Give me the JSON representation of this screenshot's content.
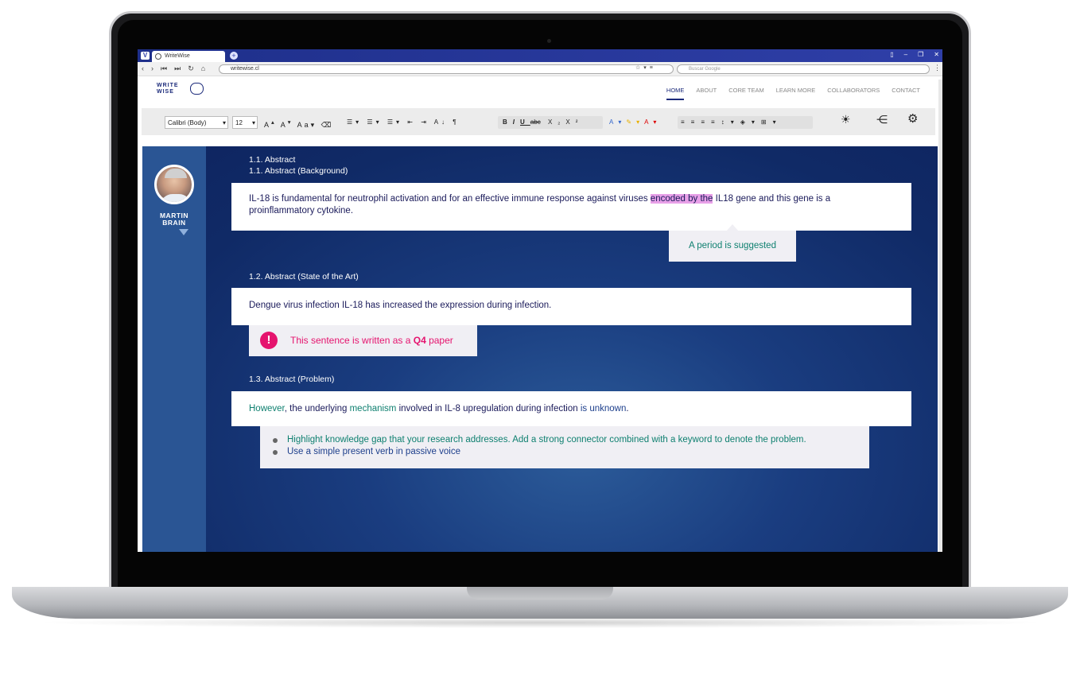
{
  "browser": {
    "tab_title": "WriteWise",
    "url": "writewise.cl",
    "search_placeholder": "Buscar Google"
  },
  "site": {
    "logo_top": "WRITE",
    "logo_bottom": "WISE",
    "nav": [
      "HOME",
      "ABOUT",
      "CORE TEAM",
      "LEARN MORE",
      "COLLABORATORS",
      "CONTACT"
    ]
  },
  "toolbar": {
    "font": "Calibri (Body)",
    "size": "12"
  },
  "user": {
    "first": "MARTIN",
    "last": "BRAIN"
  },
  "sections": {
    "s1_title": "1.1. Abstract",
    "s1_sub": "1.1. Abstract (Background)",
    "s1_text_a": "IL-18 is fundamental for neutrophil activation and for an effective immune response against viruses ",
    "s1_text_hl": "encoded by the",
    "s1_text_b": " IL18 gene and this gene is a proinflammatory cytokine.",
    "s1_tip": "A period is suggested",
    "s2_title": "1.2. Abstract (State of the Art)",
    "s2_text": "Dengue virus infection IL-18 has increased the expression during infection.",
    "s2_warn_a": "This sentence is written as a ",
    "s2_warn_b": "Q4",
    "s2_warn_c": " paper",
    "s3_title": "1.3. Abstract (Problem)",
    "s3_text_1": "However",
    "s3_text_2": ", the underlying ",
    "s3_text_3": "mechanism",
    "s3_text_4": " involved in IL-8 upregulation during infection ",
    "s3_text_5": "is unknown",
    "s3_text_6": ".",
    "s3_tip_1": "Highlight knowledge gap that your research addresses. Add a strong connector combined with a keyword to denote the problem.",
    "s3_tip_2": "Use a simple present verb in passive voice"
  }
}
